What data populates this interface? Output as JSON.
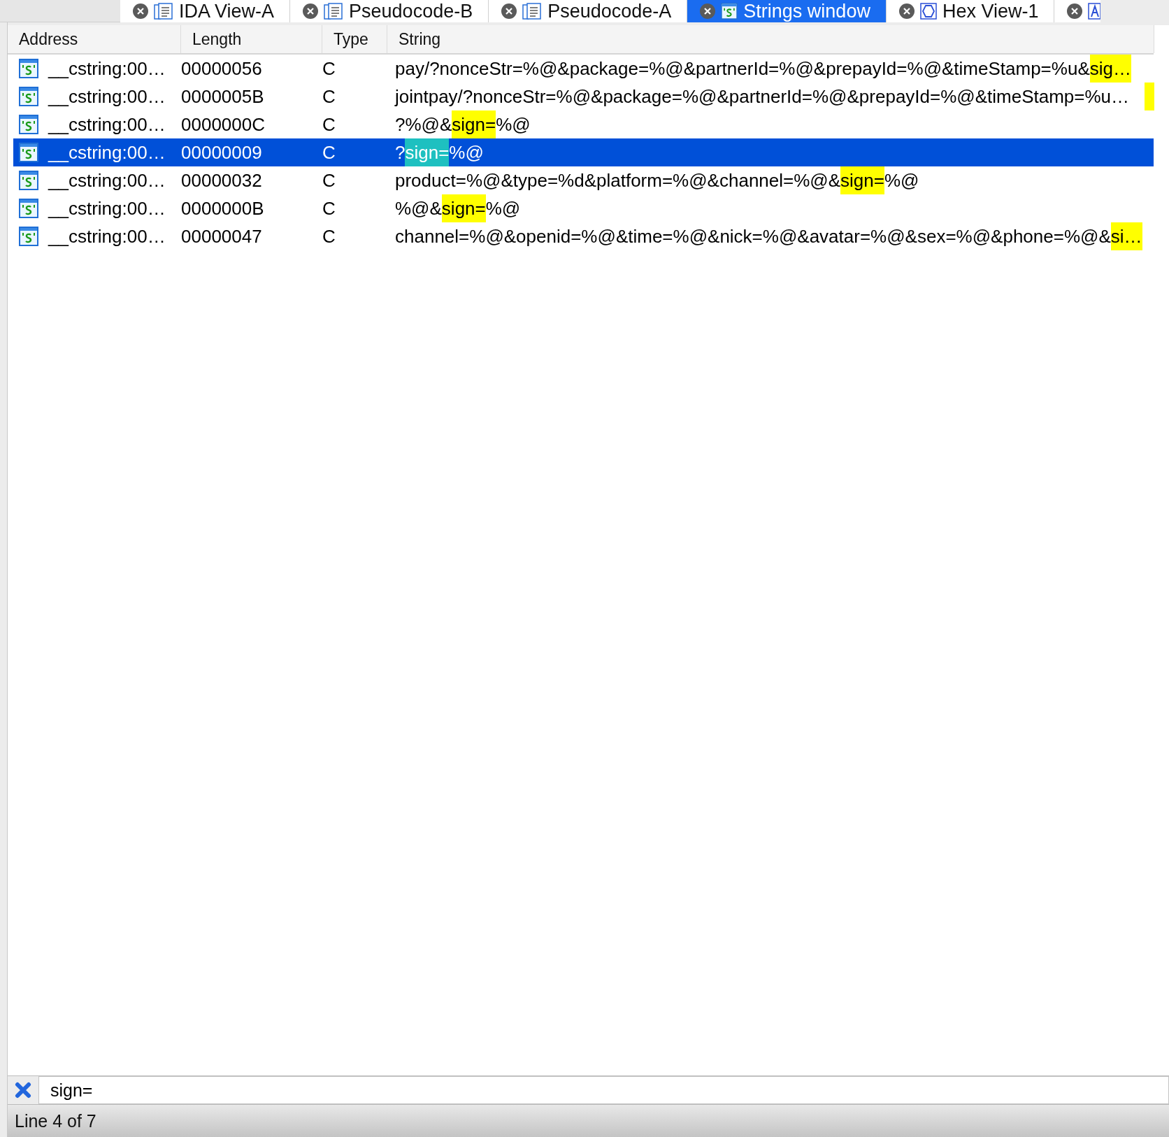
{
  "tabs": [
    {
      "kind": "document",
      "label": "IDA View-A",
      "selected": false
    },
    {
      "kind": "document",
      "label": "Pseudocode-B",
      "selected": false
    },
    {
      "kind": "document",
      "label": "Pseudocode-A",
      "selected": false
    },
    {
      "kind": "strings",
      "label": "Strings window",
      "selected": true
    },
    {
      "kind": "hex",
      "label": "Hex View-1",
      "selected": false
    },
    {
      "kind": "structure",
      "selected": false
    }
  ],
  "table": {
    "columns": [
      "Address",
      "Length",
      "Type",
      "String"
    ],
    "rows": [
      {
        "address": "__cstring:00…",
        "length": "00000056",
        "type": "C",
        "selected": false,
        "string": [
          {
            "text": "pay/?nonceStr=%@&package=%@&partnerId=%@&prepayId=%@&timeStamp=%u&",
            "match": false
          },
          {
            "text": "sig…",
            "match": true
          }
        ]
      },
      {
        "address": "__cstring:00…",
        "length": "0000005B",
        "type": "C",
        "selected": false,
        "match_tail": true,
        "string": [
          {
            "text": "jointpay/?nonceStr=%@&package=%@&partnerId=%@&prepayId=%@&timeStamp=%u…",
            "match": false
          }
        ]
      },
      {
        "address": "__cstring:00…",
        "length": "0000000C",
        "type": "C",
        "selected": false,
        "string": [
          {
            "text": "?%@&",
            "match": false
          },
          {
            "text": "sign=",
            "match": true
          },
          {
            "text": "%@",
            "match": false
          }
        ]
      },
      {
        "address": "__cstring:00…",
        "length": "00000009",
        "type": "C",
        "selected": true,
        "string": [
          {
            "text": "?",
            "match": false
          },
          {
            "text": "sign=",
            "match": true
          },
          {
            "text": "%@",
            "match": false
          }
        ]
      },
      {
        "address": "__cstring:00…",
        "length": "00000032",
        "type": "C",
        "selected": false,
        "string": [
          {
            "text": "product=%@&type=%d&platform=%@&channel=%@&",
            "match": false
          },
          {
            "text": "sign=",
            "match": true
          },
          {
            "text": "%@",
            "match": false
          }
        ]
      },
      {
        "address": "__cstring:00…",
        "length": "0000000B",
        "type": "C",
        "selected": false,
        "string": [
          {
            "text": "%@&",
            "match": false
          },
          {
            "text": "sign=",
            "match": true
          },
          {
            "text": "%@",
            "match": false
          }
        ]
      },
      {
        "address": "__cstring:00…",
        "length": "00000047",
        "type": "C",
        "selected": false,
        "string": [
          {
            "text": "channel=%@&openid=%@&time=%@&nick=%@&avatar=%@&sex=%@&phone=%@&",
            "match": false
          },
          {
            "text": "si…",
            "match": true
          }
        ]
      }
    ]
  },
  "filter": {
    "value": "sign="
  },
  "status_bar": "Line 4 of 7"
}
